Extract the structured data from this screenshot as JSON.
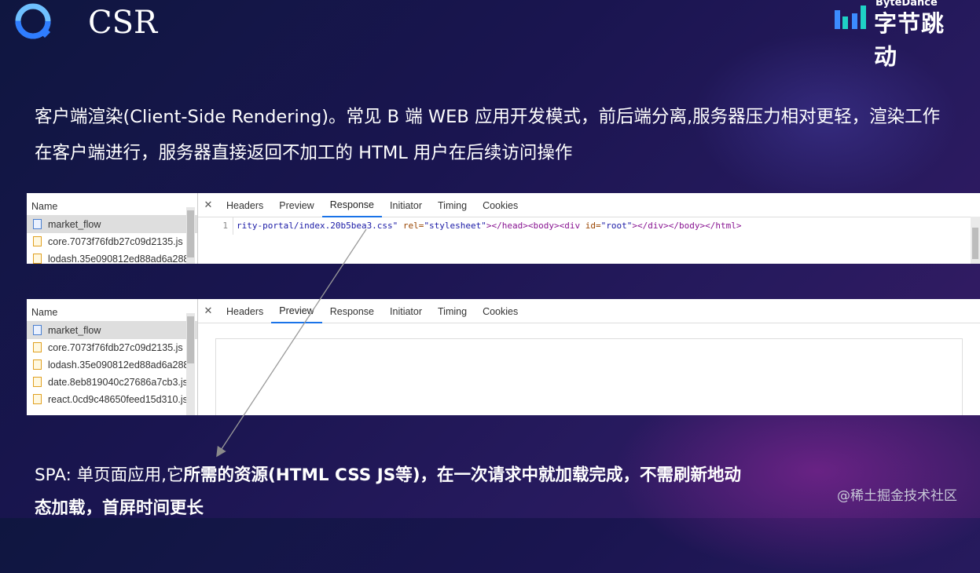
{
  "slide": {
    "title": "CSR",
    "brand_en": "ByteDance",
    "brand_cn": "字节跳动",
    "intro": "客户端渲染(Client-Side Rendering)。常见 B 端 WEB 应用开发模式，前后端分离,服务器压力相对更轻，渲染工作在客户端进行，服务器直接返回不加工的 HTML 用户在后续访问操作",
    "spa_plain": "SPA: 单页面应用,它",
    "spa_bold": "所需的资源(HTML CSS JS等)，在一次请求中就加载完成，不需刷新地动态加载，首屏时间更长",
    "watermark": "@稀土掘金技术社区"
  },
  "panel1": {
    "name_header": "Name",
    "files": [
      "market_flow",
      "core.7073f76fdb27c09d2135.js",
      "lodash.35e090812ed88ad6a288"
    ],
    "tabs": [
      "Headers",
      "Preview",
      "Response",
      "Initiator",
      "Timing",
      "Cookies"
    ],
    "active_tab": "Response",
    "line_number": "1",
    "code_pre": "rity-portal/index.20b5bea3.css\"",
    "code_rel_attr": " rel=",
    "code_rel_val": "\"stylesheet\"",
    "code_tags": "></head><body><div ",
    "code_id_attr": "id=",
    "code_id_val": "\"root\"",
    "code_end": "></div></body></html>"
  },
  "panel2": {
    "name_header": "Name",
    "files": [
      "market_flow",
      "core.7073f76fdb27c09d2135.js",
      "lodash.35e090812ed88ad6a288",
      "date.8eb819040c27686a7cb3.js",
      "react.0cd9c48650feed15d310.js"
    ],
    "tabs": [
      "Headers",
      "Preview",
      "Response",
      "Initiator",
      "Timing",
      "Cookies"
    ],
    "active_tab": "Preview"
  },
  "colors": {
    "active_tab": "#1a73e8",
    "background": "#1a1550"
  }
}
